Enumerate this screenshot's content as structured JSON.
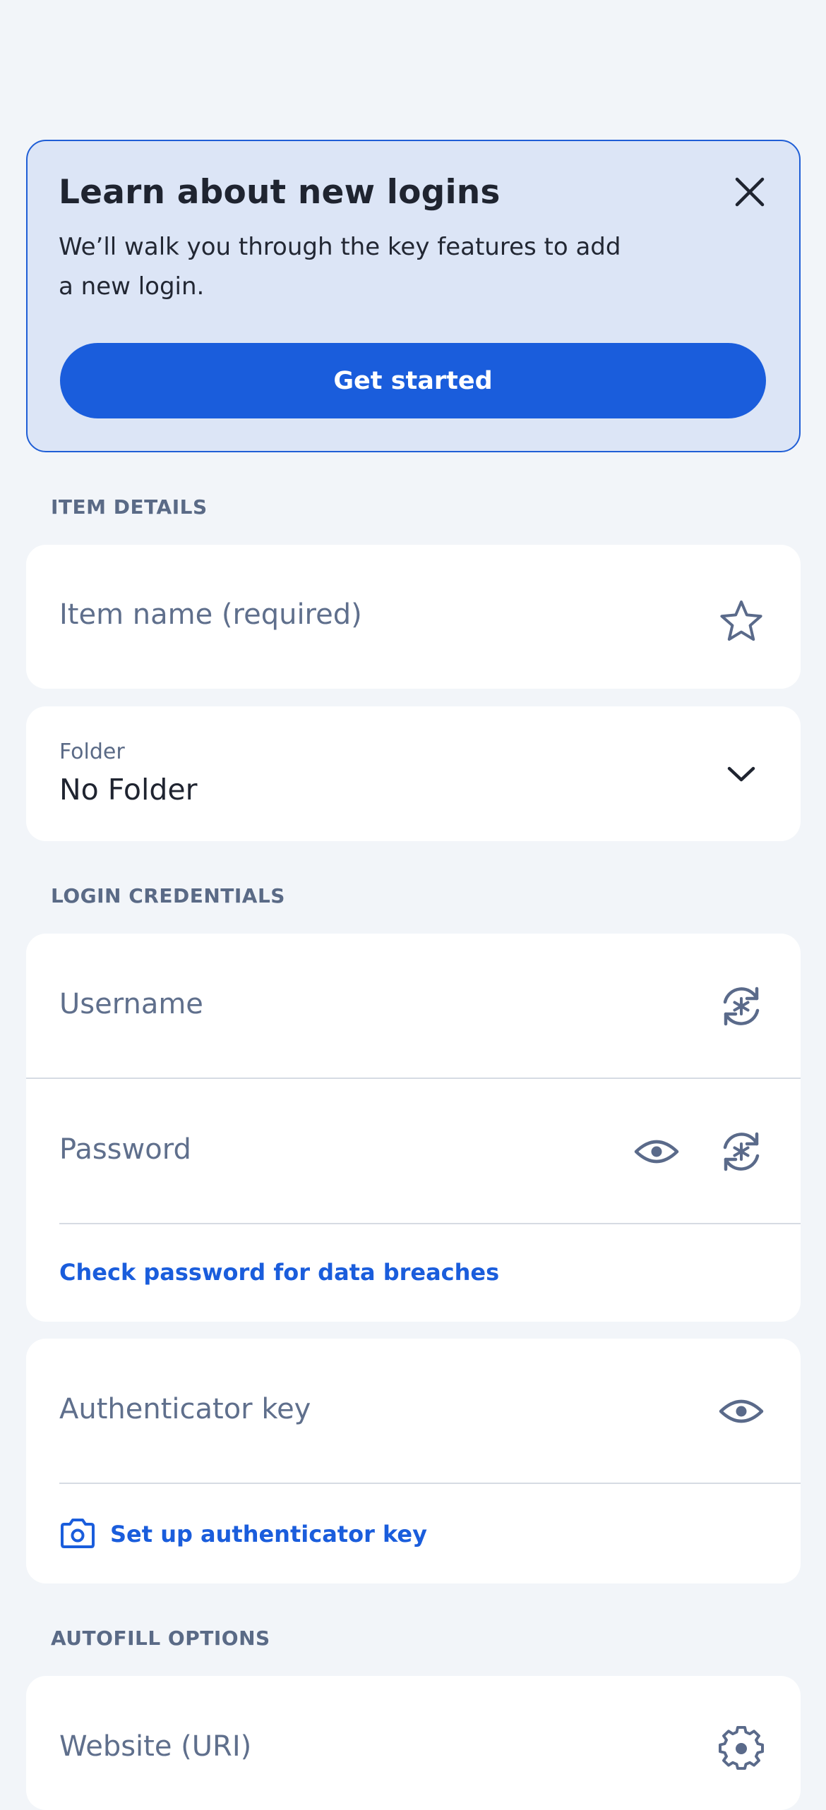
{
  "banner": {
    "title": "Learn about new logins",
    "body": "We’ll walk you through the key features to add a new login.",
    "cta": "Get started",
    "close_icon": "close-icon"
  },
  "sections": {
    "item_details": "ITEM DETAILS",
    "login_credentials": "LOGIN CREDENTIALS",
    "autofill_options": "AUTOFILL OPTIONS"
  },
  "item_name": {
    "placeholder": "Item name (required)",
    "icon": "star-icon"
  },
  "folder": {
    "label": "Folder",
    "value": "No Folder",
    "icon": "chevron-down-icon"
  },
  "username": {
    "placeholder": "Username",
    "icon": "generate-icon"
  },
  "password": {
    "placeholder": "Password",
    "view_icon": "eye-icon",
    "generate_icon": "generate-icon",
    "check_link": "Check password for data breaches"
  },
  "authenticator": {
    "placeholder": "Authenticator key",
    "view_icon": "eye-icon",
    "setup_link": "Set up authenticator key",
    "camera_icon": "camera-icon"
  },
  "website": {
    "placeholder": "Website (URI)",
    "icon": "gear-icon"
  },
  "colors": {
    "accent": "#1a5ddc",
    "background": "#f2f5f9",
    "banner_bg": "#dce5f6",
    "icon": "#5a6a8a"
  }
}
